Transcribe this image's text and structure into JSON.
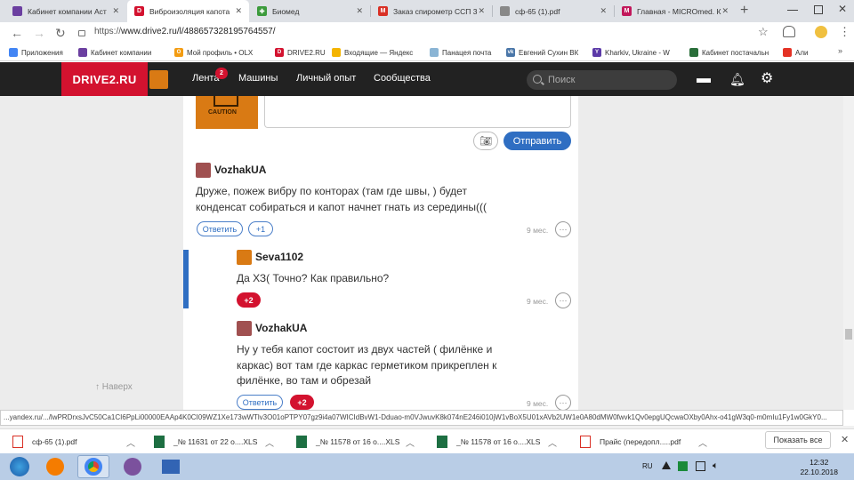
{
  "browser": {
    "tabs": [
      {
        "title": "Кабинет компании Аст",
        "fav_color": "#6b3fa0",
        "active": false
      },
      {
        "title": "Виброизоляция капота",
        "fav_color": "#d3122f",
        "active": true
      },
      {
        "title": "Биомед",
        "fav_color": "#3c9b3c",
        "active": false
      },
      {
        "title": "Заказ спирометр ССП 3",
        "fav_color": "#d93025",
        "active": false
      },
      {
        "title": "сф-65 (1).pdf",
        "fav_color": "#888888",
        "active": false
      },
      {
        "title": "Главная - MICROmed. К",
        "fav_color": "#c2185b",
        "active": false
      }
    ],
    "url_prefix": "https://",
    "url_main": "www.drive2.ru/l/488657328195764557/",
    "bookmarks": [
      {
        "label": "Приложения",
        "color": "#4285f4"
      },
      {
        "label": "Кабинет компании",
        "color": "#6b3fa0"
      },
      {
        "label": "Мой профиль • OLX",
        "color": "#f39c12"
      },
      {
        "label": "DRIVE2.RU",
        "color": "#d3122f"
      },
      {
        "label": "Входящие — Яндекс",
        "color": "#f4b400"
      },
      {
        "label": "Панацея почта",
        "color": "#8ab4d4"
      },
      {
        "label": "Евгений Сухин ВК",
        "color": "#4a76a8"
      },
      {
        "label": "Kharkiv, Ukraine - W",
        "color": "#5c3aa8"
      },
      {
        "label": "Кабинет постачальн",
        "color": "#2a6e3a"
      },
      {
        "label": "Али",
        "color": "#e43225"
      }
    ]
  },
  "site": {
    "logo": "DRIVE2.RU",
    "nav": [
      "Лента",
      "Машины",
      "Личный опыт",
      "Сообщества"
    ],
    "feed_badge": "2",
    "search_placeholder": "Поиск"
  },
  "editor": {
    "caution_label": "CAUTION",
    "send_label": "Отправить",
    "camera_icon": "camera-icon"
  },
  "comments": [
    {
      "author": "VozhakUA",
      "text_line1": "Друже, пожеж вибру по конторах (там где швы, ) будет",
      "text_line2": "конденсат собираться и капот начнет гнать из середины(((",
      "reply": "Ответить",
      "votes": "+1",
      "time": "9 мес.",
      "avatar_color": "#a05050"
    },
    {
      "author": "Seva1102",
      "text": "Да ХЗ( Точно? Как правильно?",
      "votes": "+2",
      "time": "9 мес.",
      "avatar_color": "#d97a14"
    },
    {
      "author": "VozhakUA",
      "text_line1": "Ну у тебя капот состоит из двух частей ( филёнке и",
      "text_line2": "каркас) вот там где каркас герметиком прикреплен к",
      "text_line3": "филёнке, во там и обрезай",
      "reply": "Ответить",
      "votes": "+2",
      "time": "9 мес.",
      "avatar_color": "#a05050"
    }
  ],
  "sidebar": {
    "up_label": "Наверх"
  },
  "status_url": "...yandex.ru/.../lwPRDrxsJvC50Ca1CI6PpLi00000EAAp4K0CI09WZ1Xe173wWTlv3O01oPTPY07gz9i4a07WICIdBvW1-Dduao-m0VJwuvK8k074nE246i010jW1vBoX5U01xAVb2UW1e0A80dMW0fwvk1Qv0epgUQcwaOXby0Ahx-o41gW3q0-m0mIu1Fy1w0GkY0...",
  "downloads": [
    {
      "name": "сф-65 (1).pdf",
      "type": "pdf"
    },
    {
      "name": "_№ 11631 от 22 о....XLS",
      "type": "xls"
    },
    {
      "name": "_№ 11578 от 16 о....XLS",
      "type": "xls"
    },
    {
      "name": "_№ 11578 от 16 о....XLS",
      "type": "xls"
    },
    {
      "name": "Прайс (передопл.....pdf",
      "type": "pdf"
    }
  ],
  "downloads_show_all": "Показать все",
  "taskbar": {
    "lang": "RU",
    "time": "12:32",
    "date": "22.10.2018"
  }
}
